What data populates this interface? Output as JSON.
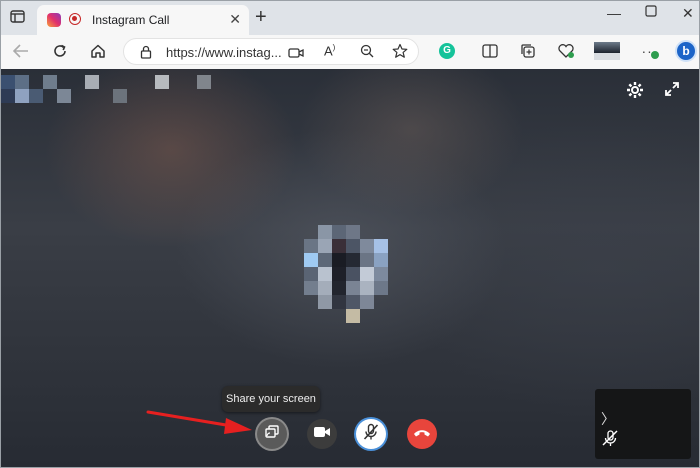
{
  "browser": {
    "tab": {
      "title": "Instagram Call"
    },
    "address": {
      "url": "https://www.instag..."
    }
  },
  "call": {
    "tooltip": "Share your screen",
    "colors": {
      "end_call": "#e8453c",
      "control_bg": "#3c3c3c",
      "mute_bg": "#ffffff"
    }
  },
  "icons": [
    "tab-actions-icon",
    "instagram-icon",
    "recording-icon",
    "close-icon",
    "new-tab-icon",
    "minimize-icon",
    "maximize-icon",
    "window-close-icon",
    "back-icon",
    "refresh-icon",
    "home-icon",
    "lock-icon",
    "video-icon",
    "read-aloud-icon",
    "zoom-icon",
    "favorite-icon",
    "grammarly-icon",
    "split-screen-icon",
    "collections-icon",
    "browser-essentials-icon",
    "more-icon",
    "bing-icon",
    "settings-icon",
    "expand-icon",
    "share-screen-icon",
    "camera-icon",
    "mic-muted-icon",
    "end-call-icon"
  ]
}
